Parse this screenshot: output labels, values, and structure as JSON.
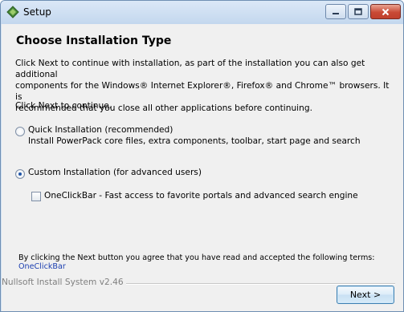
{
  "window": {
    "title": "Setup",
    "icon": "setup-app-icon",
    "controls": [
      "minimize-icon",
      "maximize-icon",
      "close-icon"
    ]
  },
  "page": {
    "heading": "Choose Installation Type",
    "paragraph_line1": "Click Next to continue with installation, as part of the installation you can also get additional",
    "paragraph_line2": "components for the Windows® Internet Explorer®, Firefox® and Chrome™ browsers. It is",
    "paragraph_line3": "recommended that you close all other applications before continuing.",
    "continue_text": "Click Next to continue."
  },
  "options": {
    "quick": {
      "label": "Quick Installation (recommended)",
      "description": "Install PowerPack core files, extra components, toolbar, start page and search",
      "selected": false
    },
    "custom": {
      "label": "Custom Installation (for advanced users)",
      "selected": true
    },
    "oneclickbar": {
      "label": "OneClickBar - Fast access to favorite portals and advanced search engine",
      "checked": false
    }
  },
  "footer": {
    "terms_text": "By clicking the Next button you agree that you have read and accepted the following terms:",
    "terms_link": "OneClickBar",
    "branding": "Nullsoft Install System v2.46",
    "next_label": "Next >"
  },
  "colors": {
    "title_bar": "#c3d7ee",
    "dialog_bg": "#f0f0f0",
    "link": "#1c3fb0",
    "radio_dot": "#1f55a8",
    "close_button": "#c94a36"
  }
}
